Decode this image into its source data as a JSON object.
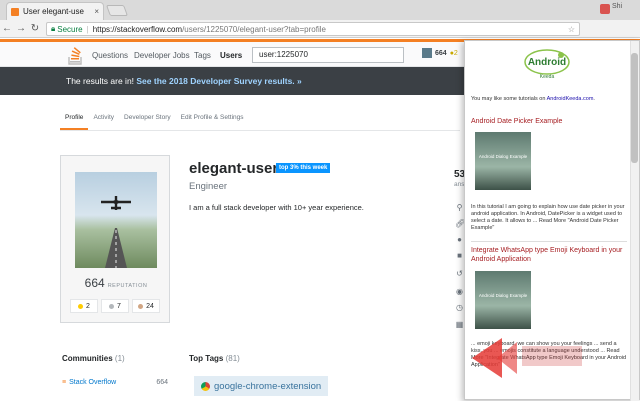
{
  "browser": {
    "tab_title": "User elegant-use",
    "tab_close": "×",
    "profile_name": "Shi",
    "secure_label": "Secure",
    "url_host": "https://stackoverflow.com",
    "url_path": "/users/1225070/elegant-user?tab=profile"
  },
  "so": {
    "nav": [
      "Questions",
      "Developer Jobs",
      "Tags",
      "Users"
    ],
    "search_value": "user:1225070",
    "user_rep": "664",
    "user_badges": "●2",
    "banner_text": "The results are in! ",
    "banner_link": "See the 2018 Developer Survey results. »"
  },
  "profile": {
    "tabs": [
      "Profile",
      "Activity",
      "Developer Story",
      "Edit Profile & Settings"
    ],
    "name": "elegant-user",
    "top_badge": "top 3% this week",
    "title": "Engineer",
    "bio": "I am a full stack developer with 10+ year experience.",
    "reputation": "664",
    "reputation_label": "REPUTATION",
    "badges": {
      "gold": "2",
      "silver": "7",
      "bronze": "24"
    },
    "stat_num": "53",
    "stat_label": "ans",
    "communities_title": "Communities",
    "communities_count": "(1)",
    "community_name": "Stack Overflow",
    "community_rep": "664",
    "top_tags_title": "Top Tags",
    "top_tags_count": "(81)",
    "top_tag": "google-chrome-extension"
  },
  "popup": {
    "logo_text": "Android",
    "logo_sub": "Keeda",
    "intro": "You may like some tutorials on ",
    "intro_site": "AndroidKeeda.com",
    "articles": [
      {
        "title": "Android Date Picker Example",
        "thumb": "Android Dialog Example",
        "body": "In this tutorial I am going to explain how use date picker in your android application. In Android, DatePicker is a widget used to select a date. It allows to ... Read More \"Android Date Picker Example\""
      },
      {
        "title": "Integrate WhatsApp type Emoji Keyboard in your Android Application",
        "thumb": "Android Dialog Example",
        "body": "... emoji keyboard, we can show you your feelings ... send a kiss, you ... emojis constitute a language understood ... Read More \"Integrate WhatsApp type Emoji Keyboard in your Android Application\""
      }
    ]
  },
  "colors": {
    "so_orange": "#f48024",
    "link_blue": "#0077cc",
    "popup_title": "#a61e22"
  }
}
